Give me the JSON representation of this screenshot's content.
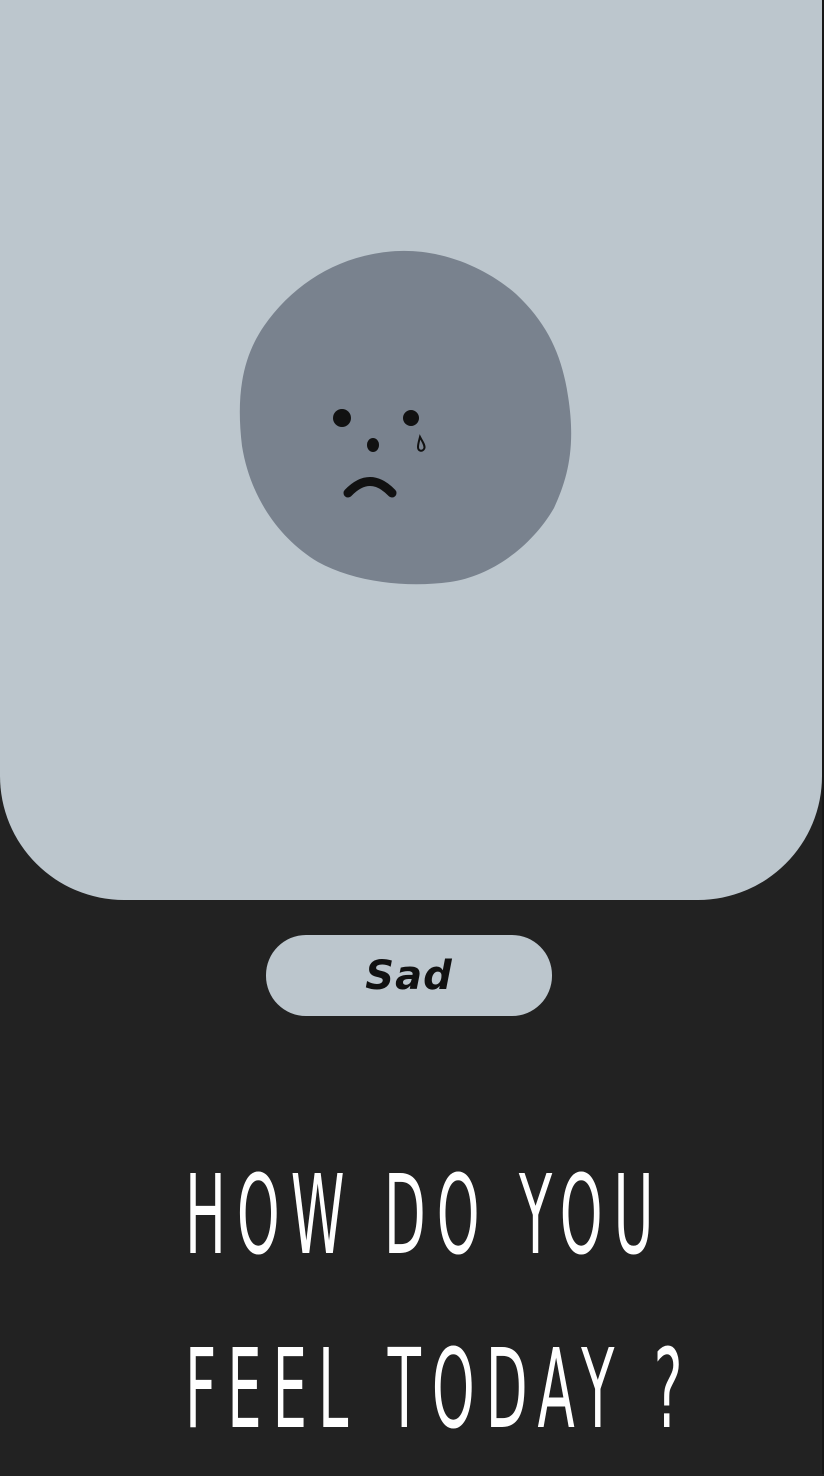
{
  "mood": {
    "label": "Sad",
    "face_icon": "sad-crying-face-icon",
    "face_color": "#79828e",
    "card_color": "#bcc6cd"
  },
  "question": {
    "line1": "HOW DO YOU",
    "line2": "FEEL TODAY ?"
  },
  "colors": {
    "background": "#222222",
    "text": "#ffffff"
  }
}
